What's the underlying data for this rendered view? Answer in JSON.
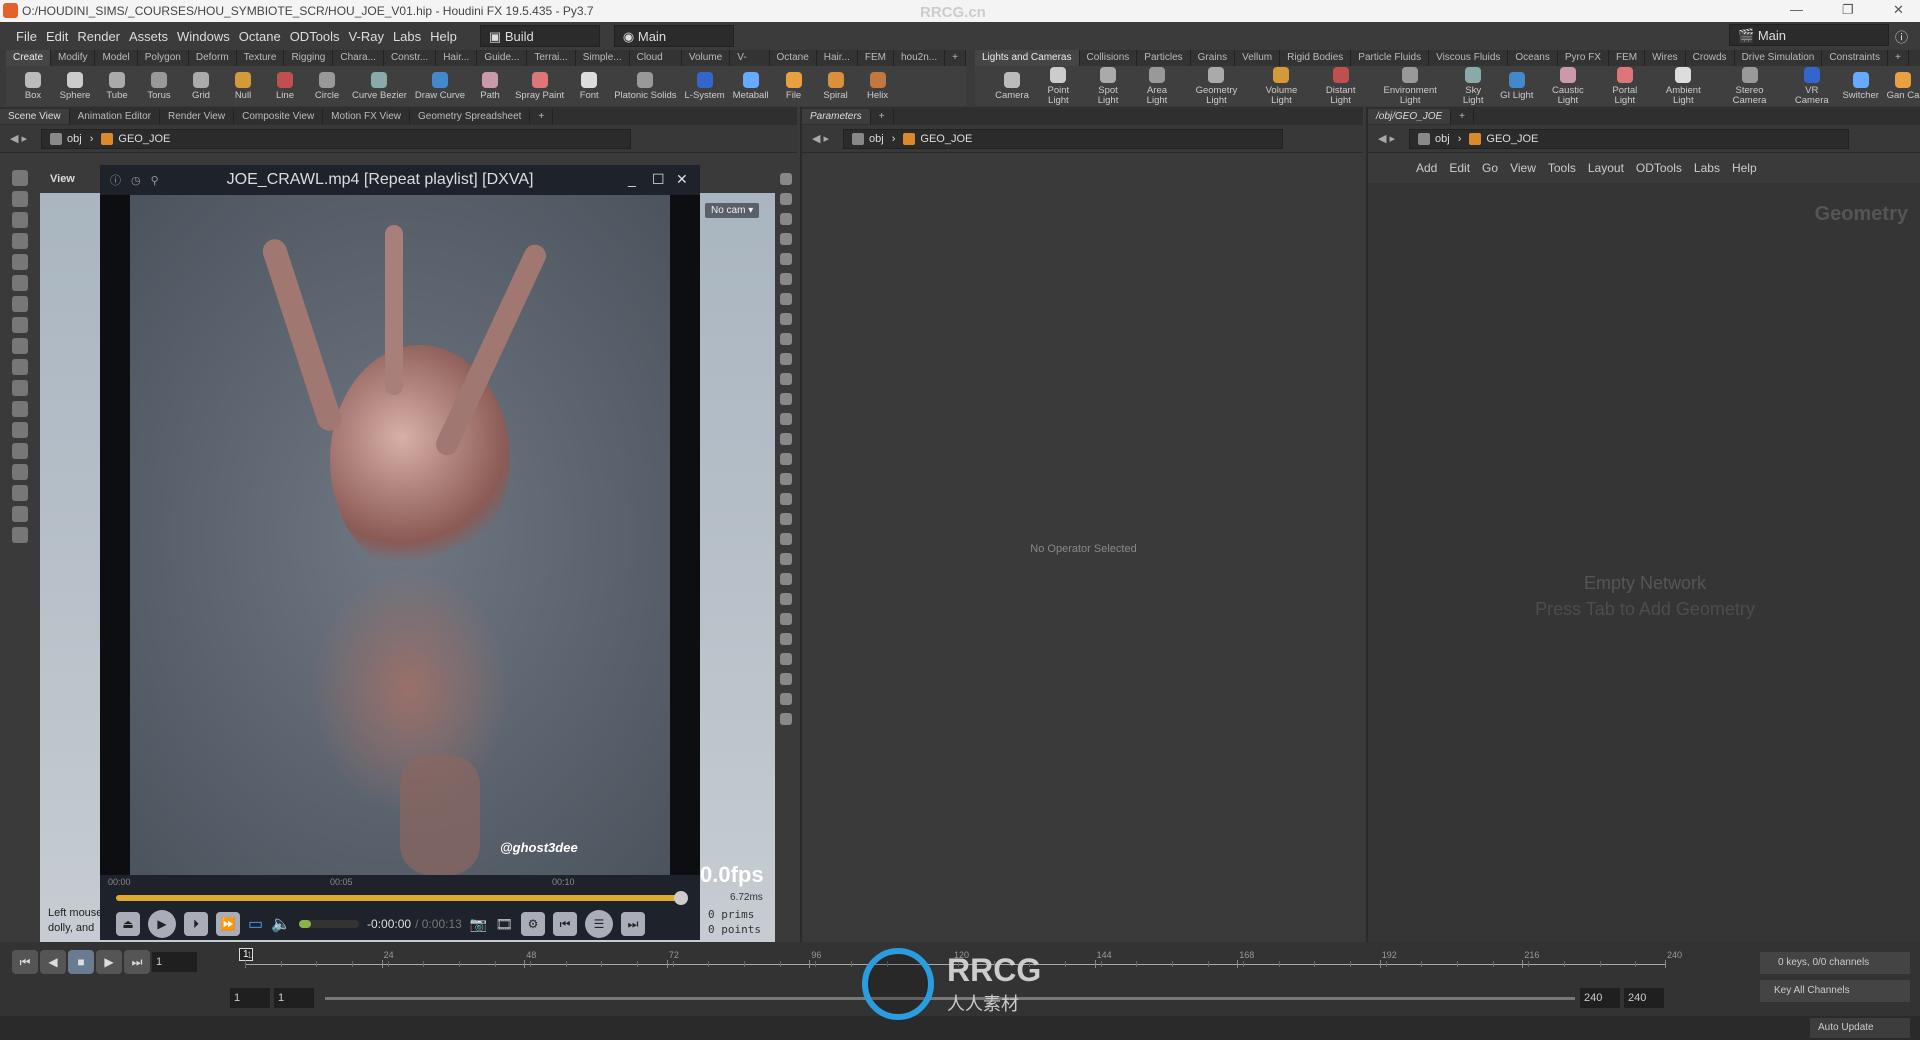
{
  "window": {
    "title": "O:/HOUDINI_SIMS/_COURSES/HOU_SYMBIOTE_SCR/HOU_JOE_V01.hip - Houdini FX 19.5.435 - Py3.7",
    "watermark": "RRCG.cn"
  },
  "menu": [
    "File",
    "Edit",
    "Render",
    "Assets",
    "Windows",
    "Octane",
    "ODTools",
    "V-Ray",
    "Labs",
    "Help"
  ],
  "desktop": "Build",
  "context": "Main",
  "desktop_right": "Main",
  "shelf_left": {
    "tabs": [
      "Create",
      "Modify",
      "Model",
      "Polygon",
      "Deform",
      "Texture",
      "Rigging",
      "Chara...",
      "Constr...",
      "Hair...",
      "Guide...",
      "Terrai...",
      "Simple...",
      "Cloud FX",
      "Volume",
      "V-Ray",
      "Octane",
      "Hair...",
      "FEM",
      "hou2n..."
    ],
    "tools": [
      "Box",
      "Sphere",
      "Tube",
      "Torus",
      "Grid",
      "Null",
      "Line",
      "Circle",
      "Curve Bezier",
      "Draw Curve",
      "Path",
      "Spray Paint",
      "Font",
      "Platonic Solids",
      "L-System",
      "Metaball",
      "File",
      "Spiral",
      "Helix"
    ]
  },
  "shelf_right": {
    "tabs": [
      "Lights and Cameras",
      "Collisions",
      "Particles",
      "Grains",
      "Vellum",
      "Rigid Bodies",
      "Particle Fluids",
      "Viscous Fluids",
      "Oceans",
      "Pyro FX",
      "FEM",
      "Wires",
      "Crowds",
      "Drive Simulation",
      "Constraints"
    ],
    "tools": [
      "Camera",
      "Point Light",
      "Spot Light",
      "Area Light",
      "Geometry Light",
      "Volume Light",
      "Distant Light",
      "Environment Light",
      "Sky Light",
      "GI Light",
      "Caustic Light",
      "Portal Light",
      "Ambient Light",
      "Stereo Camera",
      "VR Camera",
      "Switcher",
      "Gan Ca"
    ]
  },
  "scene_pane": {
    "tabs": [
      "Scene View",
      "Animation Editor",
      "Render View",
      "Composite View",
      "Motion FX View",
      "Geometry Spreadsheet"
    ],
    "path": [
      "obj",
      "GEO_JOE"
    ],
    "view_label": "View",
    "cam": "No cam",
    "fps": "0.0fps",
    "ms": "6.72ms",
    "prims": "0  prims",
    "points": "0  points",
    "hint1": "Left mouse",
    "hint2": "dolly, and"
  },
  "player": {
    "title": "JOE_CRAWL.mp4 [Repeat playlist] [DXVA]",
    "watermark": "@ghost3dee",
    "ticks": [
      "00:00",
      "00:05",
      "00:10"
    ],
    "progress": 1.0,
    "time": "-0:00:00",
    "duration": "/ 0:00:13",
    "volume": 0.1
  },
  "params_pane": {
    "tab": "Parameters",
    "path": [
      "obj",
      "GEO_JOE"
    ],
    "empty": "No Operator Selected"
  },
  "network_pane": {
    "tab": "/obj/GEO_JOE",
    "path": [
      "obj",
      "GEO_JOE"
    ],
    "menu": [
      "Add",
      "Edit",
      "Go",
      "View",
      "Tools",
      "Layout",
      "ODTools",
      "Labs",
      "Help"
    ],
    "context_label": "Geometry",
    "empty1": "Empty Network",
    "empty2": "Press Tab to Add Geometry"
  },
  "timeline": {
    "frame": "1",
    "marker": "1",
    "ticks": [
      "1",
      "24",
      "48",
      "72",
      "96",
      "120",
      "144",
      "168",
      "192",
      "216",
      "240"
    ],
    "start": "1",
    "start2": "1",
    "end": "240",
    "end2": "240",
    "keys": "0 keys, 0/0 channels",
    "key_mode": "Key All Channels",
    "update": "Auto Update"
  },
  "logo": {
    "text": "RRCG",
    "sub": "人人素材"
  }
}
